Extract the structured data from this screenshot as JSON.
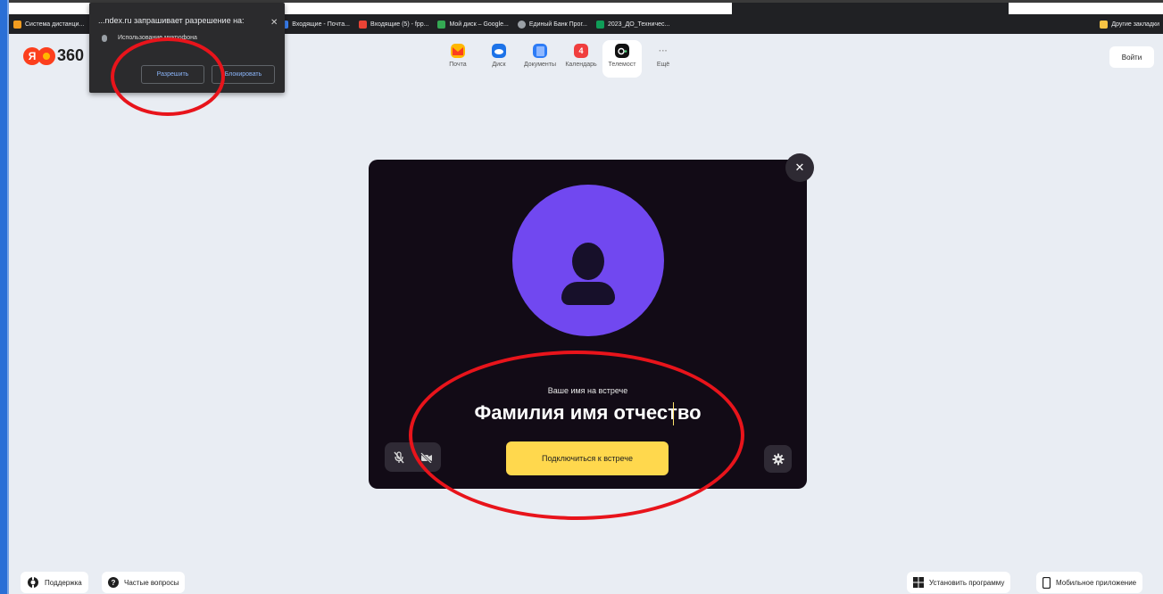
{
  "bookmarks": {
    "items": [
      "Система дистанци...",
      "Входящие - Почта...",
      "Входящие (5) - fpp...",
      "Мой диск – Google...",
      "Единый Банк Прог...",
      "2023_ДО_Техничес..."
    ],
    "other": "Другие закладки"
  },
  "header": {
    "logo_text": "360",
    "services": [
      {
        "label": "Почта",
        "icon": "mail-icon",
        "color": "#ffb800"
      },
      {
        "label": "Диск",
        "icon": "cloud-icon",
        "color": "#1d73e8"
      },
      {
        "label": "Документы",
        "icon": "docs-icon",
        "color": "#2d7cf6"
      },
      {
        "label": "Календарь",
        "icon": "calendar-icon",
        "color": "#f03e3e",
        "badge": "4"
      },
      {
        "label": "Телемост",
        "icon": "telemost-icon",
        "color": "#111111"
      },
      {
        "label": "Ещё",
        "icon": "more-icon",
        "color": "#bdbdbd"
      }
    ],
    "login": "Войти"
  },
  "permission": {
    "title": "...ndex.ru запрашивает разрешение на:",
    "description": "Использование микрофона",
    "allow": "Разрешить",
    "block": "Блокировать"
  },
  "meeting": {
    "name_caption": "Ваше имя на встрече",
    "name_value": "Фамилия имя отчество",
    "join": "Подключиться к встрече"
  },
  "footer": {
    "support": "Поддержка",
    "faq": "Частые вопросы",
    "install": "Установить программу",
    "mobile": "Мобильное приложение"
  },
  "colors": {
    "annotation": "#e8141b",
    "accent_yellow": "#ffd84d",
    "avatar": "#7148f0"
  }
}
